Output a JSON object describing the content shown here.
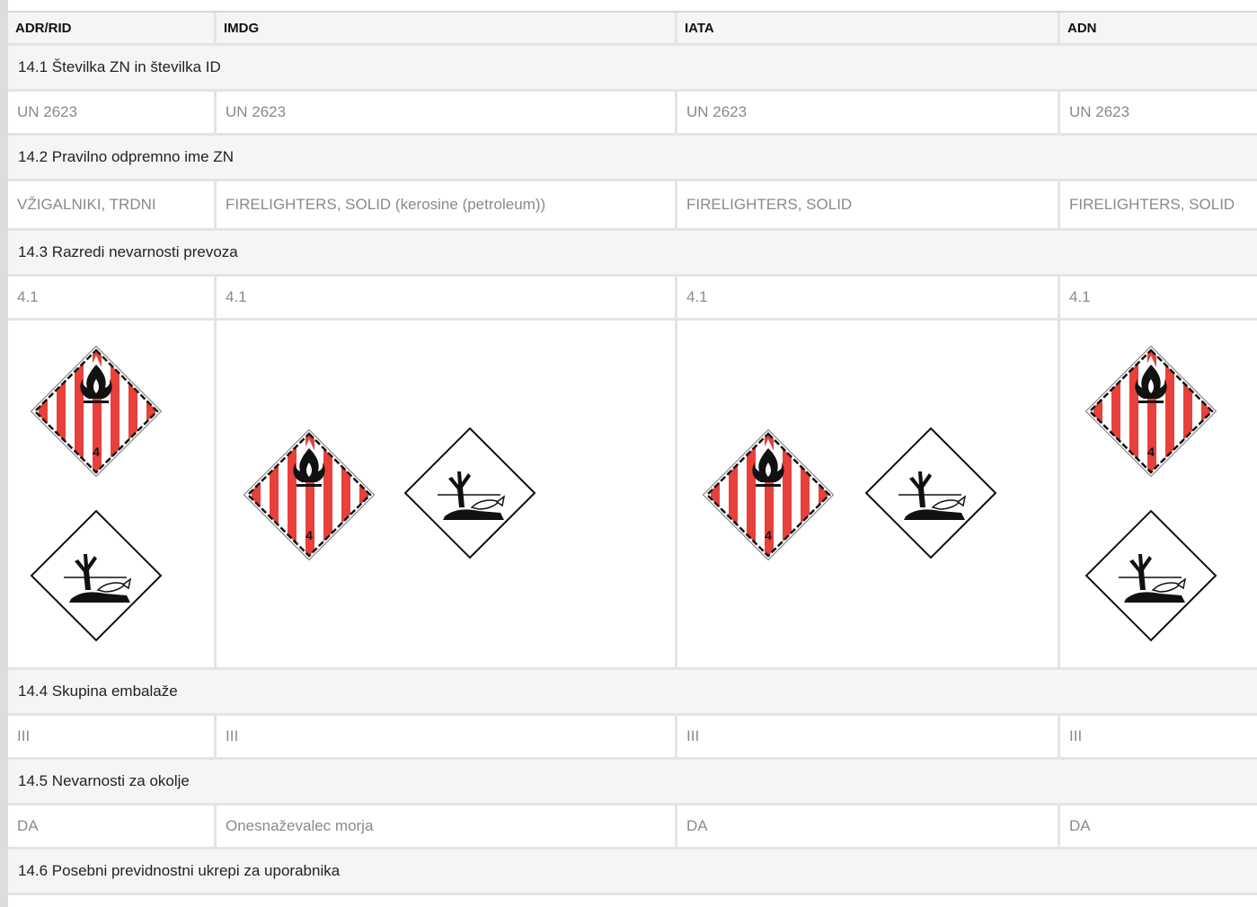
{
  "columns": [
    "ADR/RID",
    "IMDG",
    "IATA",
    "ADN"
  ],
  "sections": {
    "s1": {
      "title": "14.1 Številka ZN in številka ID",
      "values": [
        "UN 2623",
        "UN 2623",
        "UN 2623",
        "UN 2623"
      ]
    },
    "s2": {
      "title": "14.2 Pravilno odpremno ime ZN",
      "values": [
        "VŽIGALNIKI, TRDNI",
        "FIRELIGHTERS, SOLID (kerosine (petroleum))",
        "FIRELIGHTERS, SOLID",
        "FIRELIGHTERS, SOLID"
      ]
    },
    "s3": {
      "title": "14.3 Razredi nevarnosti prevoza",
      "values": [
        "4.1",
        "4.1",
        "4.1",
        "4.1"
      ]
    },
    "s4": {
      "title": "14.4 Skupina embalaže",
      "values": [
        "III",
        "III",
        "III",
        "III"
      ]
    },
    "s5": {
      "title": "14.5 Nevarnosti za okolje",
      "values": [
        "DA",
        "Onesnaževalec morja",
        "DA",
        "DA"
      ]
    },
    "s6": {
      "title": "14.6 Posebni previdnostni ukrepi za uporabnika"
    }
  },
  "hazard_labels": {
    "flammable_class_number": "4",
    "icons": [
      "flammable-solid-class-4-1-icon",
      "environmental-hazard-icon"
    ]
  },
  "colors": {
    "label_red": "#e8403a",
    "section_bg": "#f5f5f5",
    "value_text": "#8a8a8a",
    "border": "#e4e4e4"
  }
}
